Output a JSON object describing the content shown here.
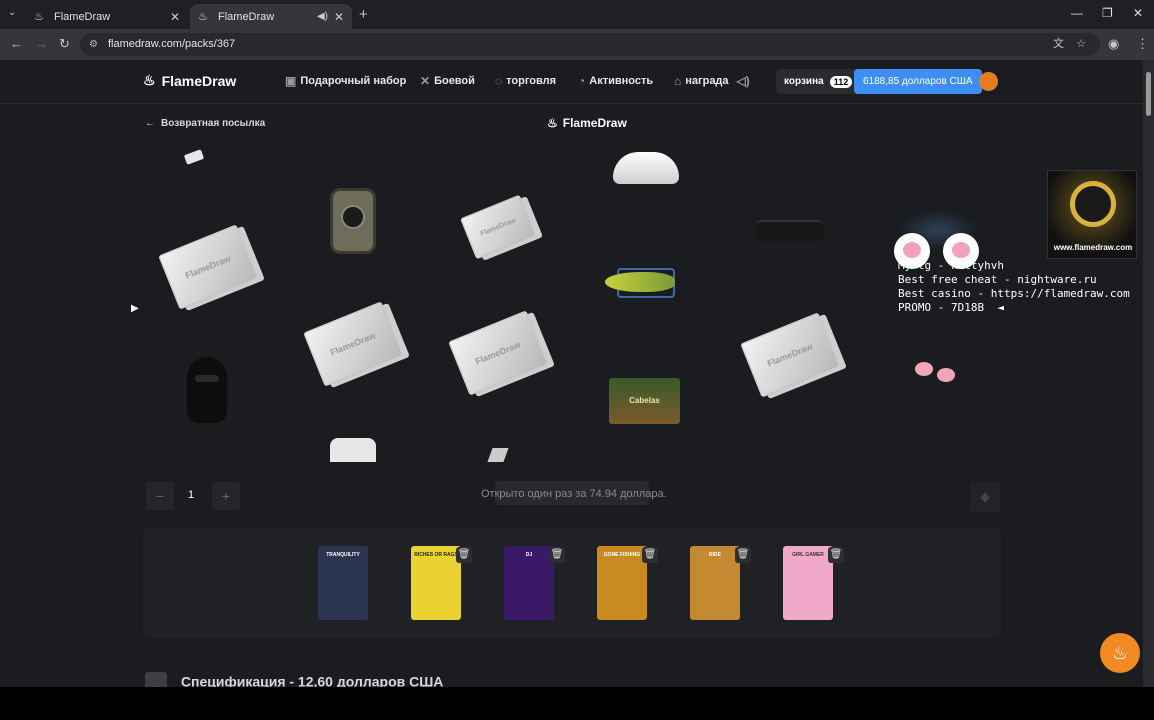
{
  "browser": {
    "tabs": [
      {
        "title": "FlameDraw"
      },
      {
        "title": "FlameDraw"
      }
    ],
    "url": "flamedraw.com/packs/367"
  },
  "nav": {
    "logo": "FlameDraw",
    "items": [
      {
        "label": "Подарочный набор",
        "icon": "gift-box-icon"
      },
      {
        "label": "Боевой",
        "icon": "swords-icon"
      },
      {
        "label": "торговля",
        "icon": "trade-icon"
      },
      {
        "label": "Активность",
        "icon": "activity-icon"
      },
      {
        "label": "награда",
        "icon": "reward-icon"
      }
    ],
    "cart_label": "корзина",
    "cart_count": "112",
    "balance": "6188,85 долларов США"
  },
  "header": {
    "back_label": "Возвратная посылка",
    "center_logo": "FlameDraw"
  },
  "reel": {
    "items": [
      {
        "name": "sneaker-item"
      },
      {
        "name": "watch-item"
      },
      {
        "name": "ticket-item",
        "text": "FlameDraw"
      },
      {
        "name": "balaclava-item"
      },
      {
        "name": "fishing-lure-item"
      },
      {
        "name": "gift-card-item",
        "text": "Cabelas"
      },
      {
        "name": "stick-item"
      }
    ]
  },
  "overlay": {
    "lines": "My tg - kittyhvh\nBest free cheat - nightware.ru\nBest casino - https://flamedraw.com\nPROMO - 7D18B  ◄",
    "ad_text": "www.flamedraw.com"
  },
  "controls": {
    "minus": "−",
    "quantity": "1",
    "plus": "+",
    "open_label": "Открыто один раз за 74.94 доллара."
  },
  "packs": [
    {
      "name": "TRANQUILITY",
      "color": "#2a3550",
      "deletable": false
    },
    {
      "name": "RICHES OR RAGS",
      "color": "#e9d232",
      "deletable": true
    },
    {
      "name": "DJ",
      "color": "#3a1a66",
      "deletable": true
    },
    {
      "name": "GONE FISHING",
      "color": "#c98a22",
      "deletable": true
    },
    {
      "name": "RIDE",
      "color": "#c38a31",
      "deletable": true
    },
    {
      "name": "GIRL GAMER",
      "color": "#f1a9c9",
      "deletable": true
    }
  ],
  "bottom": {
    "partial_title": "Спецификация - 12,60 долларов США"
  },
  "colors": {
    "accent": "#3d8ff5",
    "brand_orange": "#f18a23"
  }
}
